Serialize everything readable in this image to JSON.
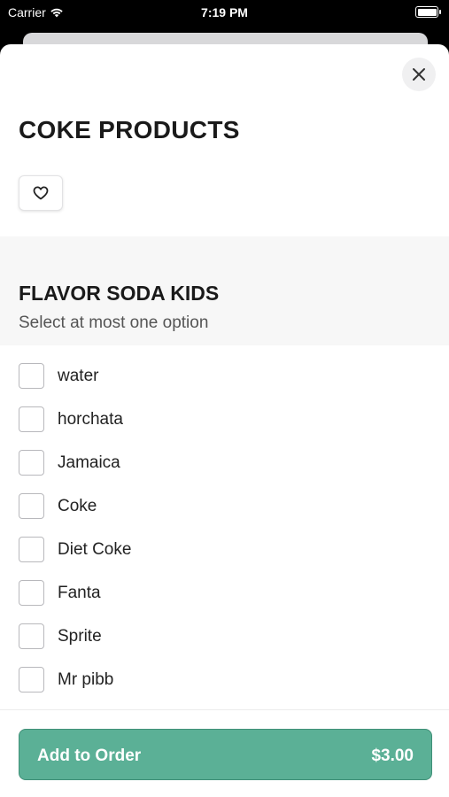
{
  "status_bar": {
    "carrier": "Carrier",
    "time": "7:19 PM"
  },
  "product": {
    "title": "COKE PRODUCTS"
  },
  "section": {
    "title": "FLAVOR SODA KIDS",
    "subtitle": "Select at most one option"
  },
  "options": [
    {
      "label": "water"
    },
    {
      "label": "horchata"
    },
    {
      "label": "Jamaica"
    },
    {
      "label": "Coke"
    },
    {
      "label": "Diet Coke"
    },
    {
      "label": "Fanta"
    },
    {
      "label": "Sprite"
    },
    {
      "label": "Mr pibb"
    }
  ],
  "footer": {
    "add_label": "Add to Order",
    "price": "$3.00"
  },
  "colors": {
    "accent": "#5bb096",
    "accent_border": "#3f8f77"
  }
}
